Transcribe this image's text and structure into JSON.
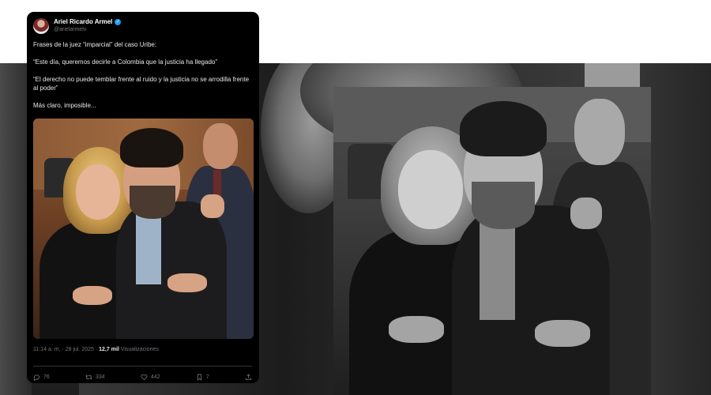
{
  "tweet": {
    "author_name": "Ariel Ricardo Armel",
    "author_handle": "@arielarmelv",
    "text_lines": [
      "Frases de la juez “imparcial” del caso Uribe:",
      "“Este día, queremos decirle a Colombia que la justicia ha llegado”",
      "“El derecho no puede temblar frente al ruido y la justicia no se arrodilla frente al poder”",
      "Más claro, imposible..."
    ],
    "timestamp": "11:14 a. m. · 28 jul. 2025 ·",
    "views_count": "12,7 mil",
    "views_label": "Visualizaciones",
    "actions": {
      "replies": "76",
      "reposts": "334",
      "likes": "442",
      "bookmarks": "7"
    }
  },
  "colors": {
    "tweet_background": "#000000",
    "verified_badge": "#1d9bf0",
    "secondary_text": "#71767b"
  },
  "icons": [
    "verified-icon",
    "reply-icon",
    "repost-icon",
    "like-icon",
    "bookmark-icon",
    "share-icon"
  ]
}
